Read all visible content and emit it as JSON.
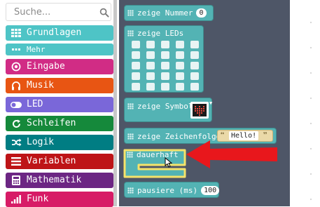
{
  "search": {
    "placeholder": "Suche..."
  },
  "categories": [
    {
      "label": "Grundlagen",
      "color": "#4ec4c6",
      "icon": "grid-icon"
    },
    {
      "label": "Mehr",
      "color": "#4ec4c6",
      "icon": "dots-icon"
    },
    {
      "label": "Eingabe",
      "color": "#d12c85",
      "icon": "target-icon"
    },
    {
      "label": "Musik",
      "color": "#e85513",
      "icon": "headphones-icon"
    },
    {
      "label": "LED",
      "color": "#7a67d9",
      "icon": "toggle-icon"
    },
    {
      "label": "Schleifen",
      "color": "#15893b",
      "icon": "refresh-icon"
    },
    {
      "label": "Logik",
      "color": "#007d83",
      "icon": "shuffle-icon"
    },
    {
      "label": "Variablen",
      "color": "#be1417",
      "icon": "list-icon"
    },
    {
      "label": "Mathematik",
      "color": "#6c2683",
      "icon": "calculator-icon"
    },
    {
      "label": "Funk",
      "color": "#d71b66",
      "icon": "signal-icon"
    }
  ],
  "blocks": {
    "show_number": {
      "label": "zeige Nummer",
      "value": "0"
    },
    "show_leds": {
      "label": "zeige LEDs"
    },
    "show_icon": {
      "label": "zeige Symbol"
    },
    "show_string": {
      "label": "zeige Zeichenfolge",
      "value": "Hello!"
    },
    "forever": {
      "label": "dauerhaft"
    },
    "pause": {
      "label": "pausiere (ms)",
      "value": "100"
    }
  },
  "colors": {
    "basic_block": "#53b3b4",
    "workspace": "#4e5667",
    "highlight": "#f5e36a",
    "arrow": "#e8171c"
  }
}
